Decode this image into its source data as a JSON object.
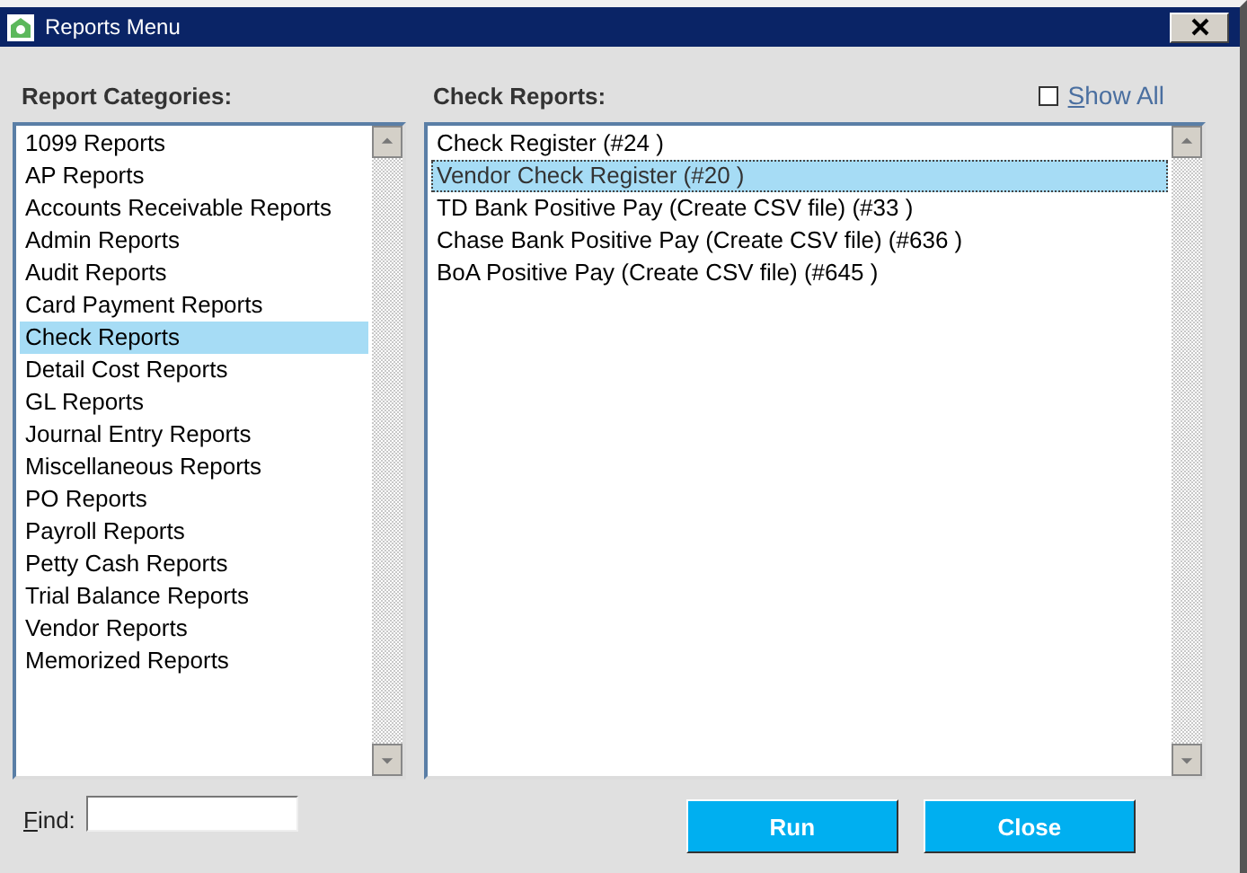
{
  "window": {
    "title": "Reports Menu"
  },
  "categories": {
    "label": "Report Categories:",
    "items": [
      {
        "label": "1099 Reports",
        "selected": false
      },
      {
        "label": "AP Reports",
        "selected": false
      },
      {
        "label": "Accounts Receivable Reports",
        "selected": false
      },
      {
        "label": "Admin Reports",
        "selected": false
      },
      {
        "label": "Audit Reports",
        "selected": false
      },
      {
        "label": "Card Payment Reports",
        "selected": false
      },
      {
        "label": "Check Reports",
        "selected": true
      },
      {
        "label": "Detail Cost Reports",
        "selected": false
      },
      {
        "label": "GL Reports",
        "selected": false
      },
      {
        "label": "Journal Entry Reports",
        "selected": false
      },
      {
        "label": "Miscellaneous Reports",
        "selected": false
      },
      {
        "label": "PO Reports",
        "selected": false
      },
      {
        "label": "Payroll Reports",
        "selected": false
      },
      {
        "label": "Petty Cash Reports",
        "selected": false
      },
      {
        "label": "Trial Balance Reports",
        "selected": false
      },
      {
        "label": "Vendor Reports",
        "selected": false
      },
      {
        "label": "Memorized Reports",
        "selected": false
      }
    ]
  },
  "reports": {
    "label": "Check Reports:",
    "show_all": {
      "label": "Show All",
      "checked": false
    },
    "items": [
      {
        "label": "Check Register (#24 )",
        "selected": false
      },
      {
        "label": "Vendor Check Register (#20 )",
        "selected": true
      },
      {
        "label": "TD Bank Positive Pay (Create CSV file) (#33 )",
        "selected": false
      },
      {
        "label": "Chase Bank Positive Pay (Create CSV file) (#636 )",
        "selected": false
      },
      {
        "label": "BoA Positive Pay (Create CSV file) (#645 )",
        "selected": false
      }
    ]
  },
  "find": {
    "label": "Find:"
  },
  "buttons": [
    {
      "label": "Run"
    },
    {
      "label": "Close"
    }
  ]
}
